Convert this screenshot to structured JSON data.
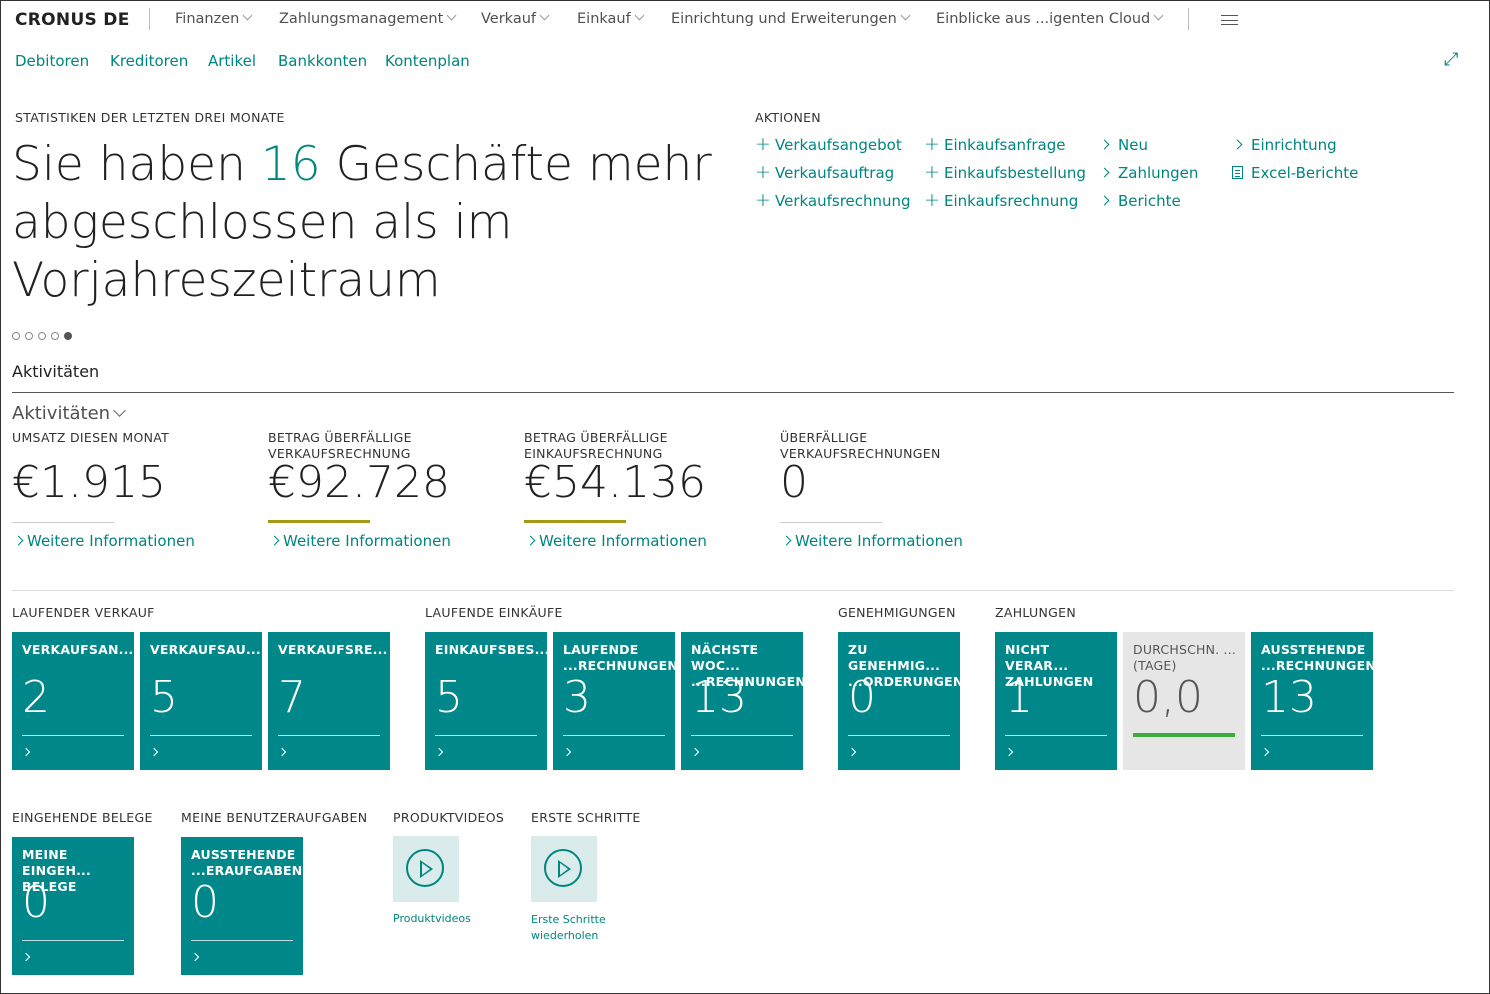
{
  "header": {
    "brand": "CRONUS DE",
    "menu": [
      "Finanzen",
      "Zahlungsmanagement",
      "Verkauf",
      "Einkauf",
      "Einrichtung und Erweiterungen",
      "Einblicke aus ...igenten Cloud"
    ],
    "nav": [
      "Debitoren",
      "Kreditoren",
      "Artikel",
      "Bankkonten",
      "Kontenplan"
    ]
  },
  "headline": {
    "caption": "STATISTIKEN DER LETZTEN DREI MONATE",
    "before": "Sie haben ",
    "number": "16",
    "after": " Geschäfte mehr abgeschlossen als im Vorjahreszeitraum",
    "dots_total": 5,
    "dots_active": 5
  },
  "actions": {
    "title": "AKTIONEN",
    "col1": [
      "Verkaufsangebot",
      "Verkaufsauftrag",
      "Verkaufsrechnung"
    ],
    "col2": [
      "Einkaufsanfrage",
      "Einkaufsbestellung",
      "Einkaufsrechnung"
    ],
    "col3": [
      "Neu",
      "Zahlungen",
      "Berichte"
    ],
    "col4": [
      "Einrichtung",
      "Excel-Berichte"
    ]
  },
  "activities": {
    "section_title": "Aktivitäten",
    "sub_title": "Aktivitäten",
    "kpis": [
      {
        "label": "UMSATZ DIESEN MONAT",
        "value": "€1.915",
        "more": "Weitere Informationen",
        "bar_color": "#cccccc"
      },
      {
        "label": "BETRAG ÜBERFÄLLIGE VERKAUFSRECHNUNG",
        "value": "€92.728",
        "more": "Weitere Informationen",
        "bar_color": "#a39b14"
      },
      {
        "label": "BETRAG ÜBERFÄLLIGE EINKAUFSRECHNUNG",
        "value": "€54.136",
        "more": "Weitere Informationen",
        "bar_color": "#a39b14"
      },
      {
        "label": "ÜBERFÄLLIGE VERKAUFSRECHNUNGEN",
        "value": "0",
        "more": "Weitere Informationen",
        "bar_color": "#cccccc"
      }
    ]
  },
  "groups": {
    "laufender_verkauf": {
      "title": "LAUFENDER VERKAUF",
      "tiles": [
        {
          "label": "VERKAUFSAN...",
          "value": "2"
        },
        {
          "label": "VERKAUFSAU...",
          "value": "5"
        },
        {
          "label": "VERKAUFSRE...",
          "value": "7"
        }
      ]
    },
    "laufende_einkaeufe": {
      "title": "LAUFENDE EINKÄUFE",
      "tiles": [
        {
          "label": "EINKAUFSBES...",
          "value": "5"
        },
        {
          "label": "LAUFENDE ...RECHNUNGEN",
          "value": "3"
        },
        {
          "label": "NÄCHSTE WOC... ...RECHNUNGEN",
          "value": "13"
        }
      ]
    },
    "genehmigungen": {
      "title": "GENEHMIGUNGEN",
      "tiles": [
        {
          "label": "ZU GENEHMIG... ...ORDERUNGEN",
          "value": "0"
        }
      ]
    },
    "zahlungen": {
      "title": "ZAHLUNGEN",
      "tiles": [
        {
          "label": "NICHT VERAR... ZAHLUNGEN",
          "value": "1"
        },
        {
          "label": "DURCHSCHN. ... (TAGE)",
          "value": "0,0"
        },
        {
          "label": "AUSSTEHENDE ...RECHNUNGEN",
          "value": "13"
        }
      ]
    },
    "eingehende_belege": {
      "title": "EINGEHENDE BELEGE",
      "tiles": [
        {
          "label": "MEINE EINGEH... BELEGE",
          "value": "0"
        }
      ]
    },
    "benutzeraufgaben": {
      "title": "MEINE BENUTZERAUFGABEN",
      "tiles": [
        {
          "label": "AUSSTEHENDE ...ERAUFGABEN",
          "value": "0"
        }
      ]
    },
    "produktvideos": {
      "title": "PRODUKTVIDEOS",
      "label": "Produktvideos"
    },
    "erste_schritte": {
      "title": "ERSTE SCHRITTE",
      "label": "Erste Schritte wiederholen"
    }
  },
  "colors": {
    "accent": "#00857f",
    "tile": "#00878a",
    "tile_grey": "#e6e6e6",
    "good": "#3cad3c",
    "warning": "#a39b14"
  }
}
